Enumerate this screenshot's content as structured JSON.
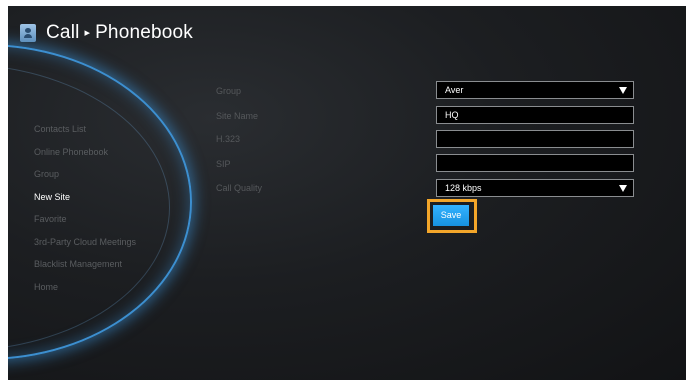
{
  "header": {
    "title": "Call",
    "separator": "▸",
    "subtitle": "Phonebook",
    "icon": "phonebook-icon"
  },
  "sidebar": {
    "items": [
      {
        "label": "Contacts List"
      },
      {
        "label": "Online Phonebook"
      },
      {
        "label": "Group"
      },
      {
        "label": "New Site",
        "active": true
      },
      {
        "label": "Favorite"
      },
      {
        "label": "3rd-Party Cloud Meetings"
      },
      {
        "label": "Blacklist Management"
      },
      {
        "label": "Home"
      }
    ]
  },
  "form": {
    "group": {
      "label": "Group",
      "value": "Aver"
    },
    "site_name": {
      "label": "Site Name",
      "value": "HQ"
    },
    "h323": {
      "label": "H.323",
      "value": ""
    },
    "sip": {
      "label": "SIP",
      "value": ""
    },
    "call_quality": {
      "label": "Call Quality",
      "value": "128 kbps"
    },
    "save_label": "Save"
  },
  "colors": {
    "accent": "#1a9ef0",
    "highlight": "#f3a62a",
    "arc": "#3c8fd0"
  }
}
